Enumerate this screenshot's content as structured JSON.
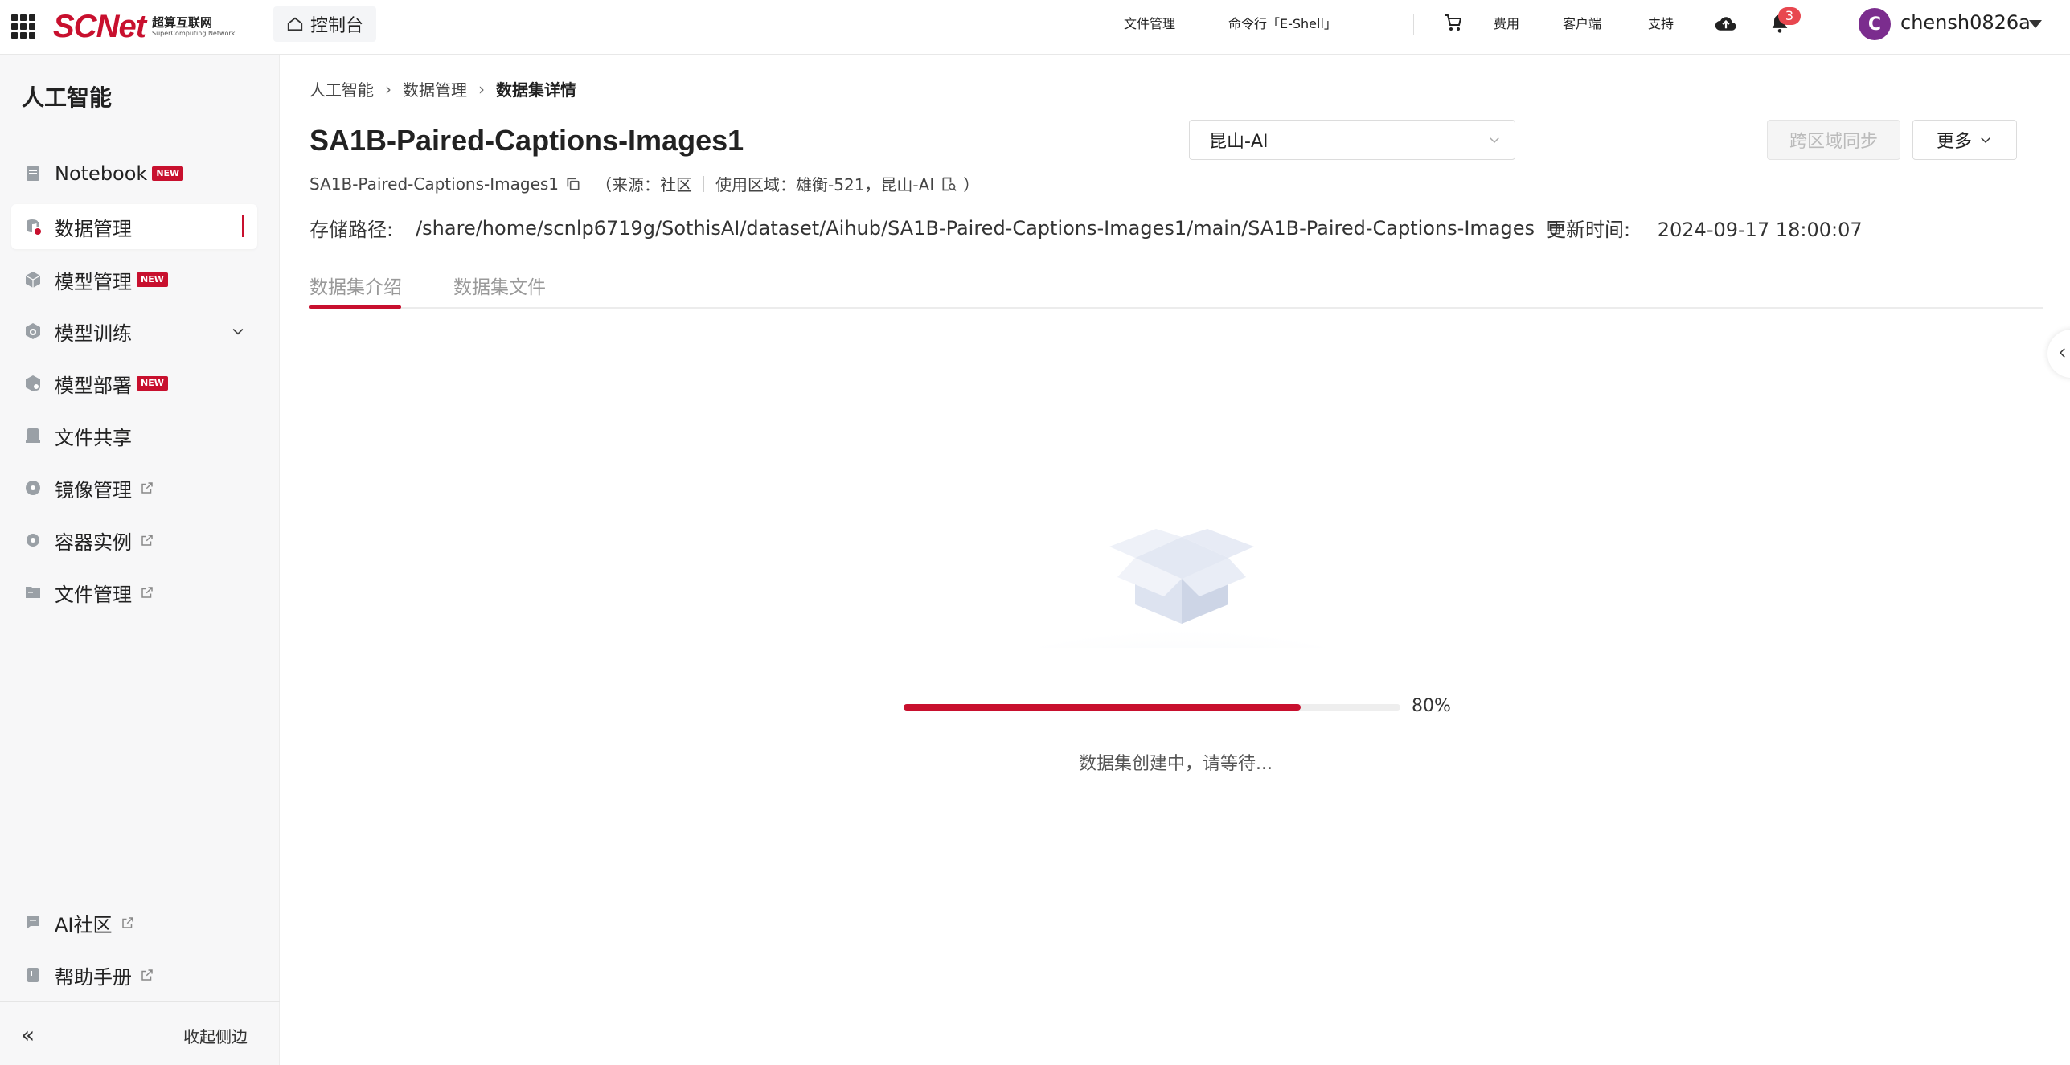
{
  "brand": {
    "logo": "SCNet",
    "sub_cn": "超算互联网",
    "sub_en": "SuperComputing Network"
  },
  "topbar": {
    "console_label": "控制台",
    "file_manage": "文件管理",
    "eshell": "命令行「E-Shell」",
    "fees": "费用",
    "client": "客户端",
    "support": "支持",
    "notification_count": "3",
    "avatar_letter": "C",
    "username": "chensh0826a"
  },
  "sidebar": {
    "title": "人工智能",
    "items": [
      {
        "label": "Notebook",
        "new": "NEW"
      },
      {
        "label": "数据管理"
      },
      {
        "label": "模型管理",
        "new": "NEW"
      },
      {
        "label": "模型训练"
      },
      {
        "label": "模型部署",
        "new": "NEW"
      },
      {
        "label": "文件共享"
      },
      {
        "label": "镜像管理"
      },
      {
        "label": "容器实例"
      },
      {
        "label": "文件管理"
      }
    ],
    "bottom_items": [
      {
        "label": "AI社区"
      },
      {
        "label": "帮助手册"
      }
    ],
    "collapse_label": "收起侧边"
  },
  "breadcrumb": [
    "人工智能",
    "数据管理",
    "数据集详情"
  ],
  "dataset": {
    "title": "SA1B-Paired-Captions-Images1",
    "name": "SA1B-Paired-Captions-Images1",
    "source_label": "（来源：社区",
    "region_label": "使用区域：雄衡-521，昆山-AI",
    "paren_close": "）",
    "storage_label": "存储路径:",
    "storage_path": "/share/home/scnlp6719g/SothisAI/dataset/Aihub/SA1B-Paired-Captions-Images1/main/SA1B-Paired-Captions-Images",
    "update_label": "更新时间:",
    "update_time": "2024-09-17 18:00:07"
  },
  "actions": {
    "region_value": "昆山-AI",
    "sync_label": "跨区域同步",
    "more_label": "更多"
  },
  "tabs": [
    "数据集介绍",
    "数据集文件"
  ],
  "progress": {
    "value": 0.8,
    "label": "80%",
    "status": "数据集创建中，请等待..."
  },
  "colors": {
    "accent": "#c8102e",
    "badge": "#e8474f",
    "avatar": "#7b2d8e"
  }
}
